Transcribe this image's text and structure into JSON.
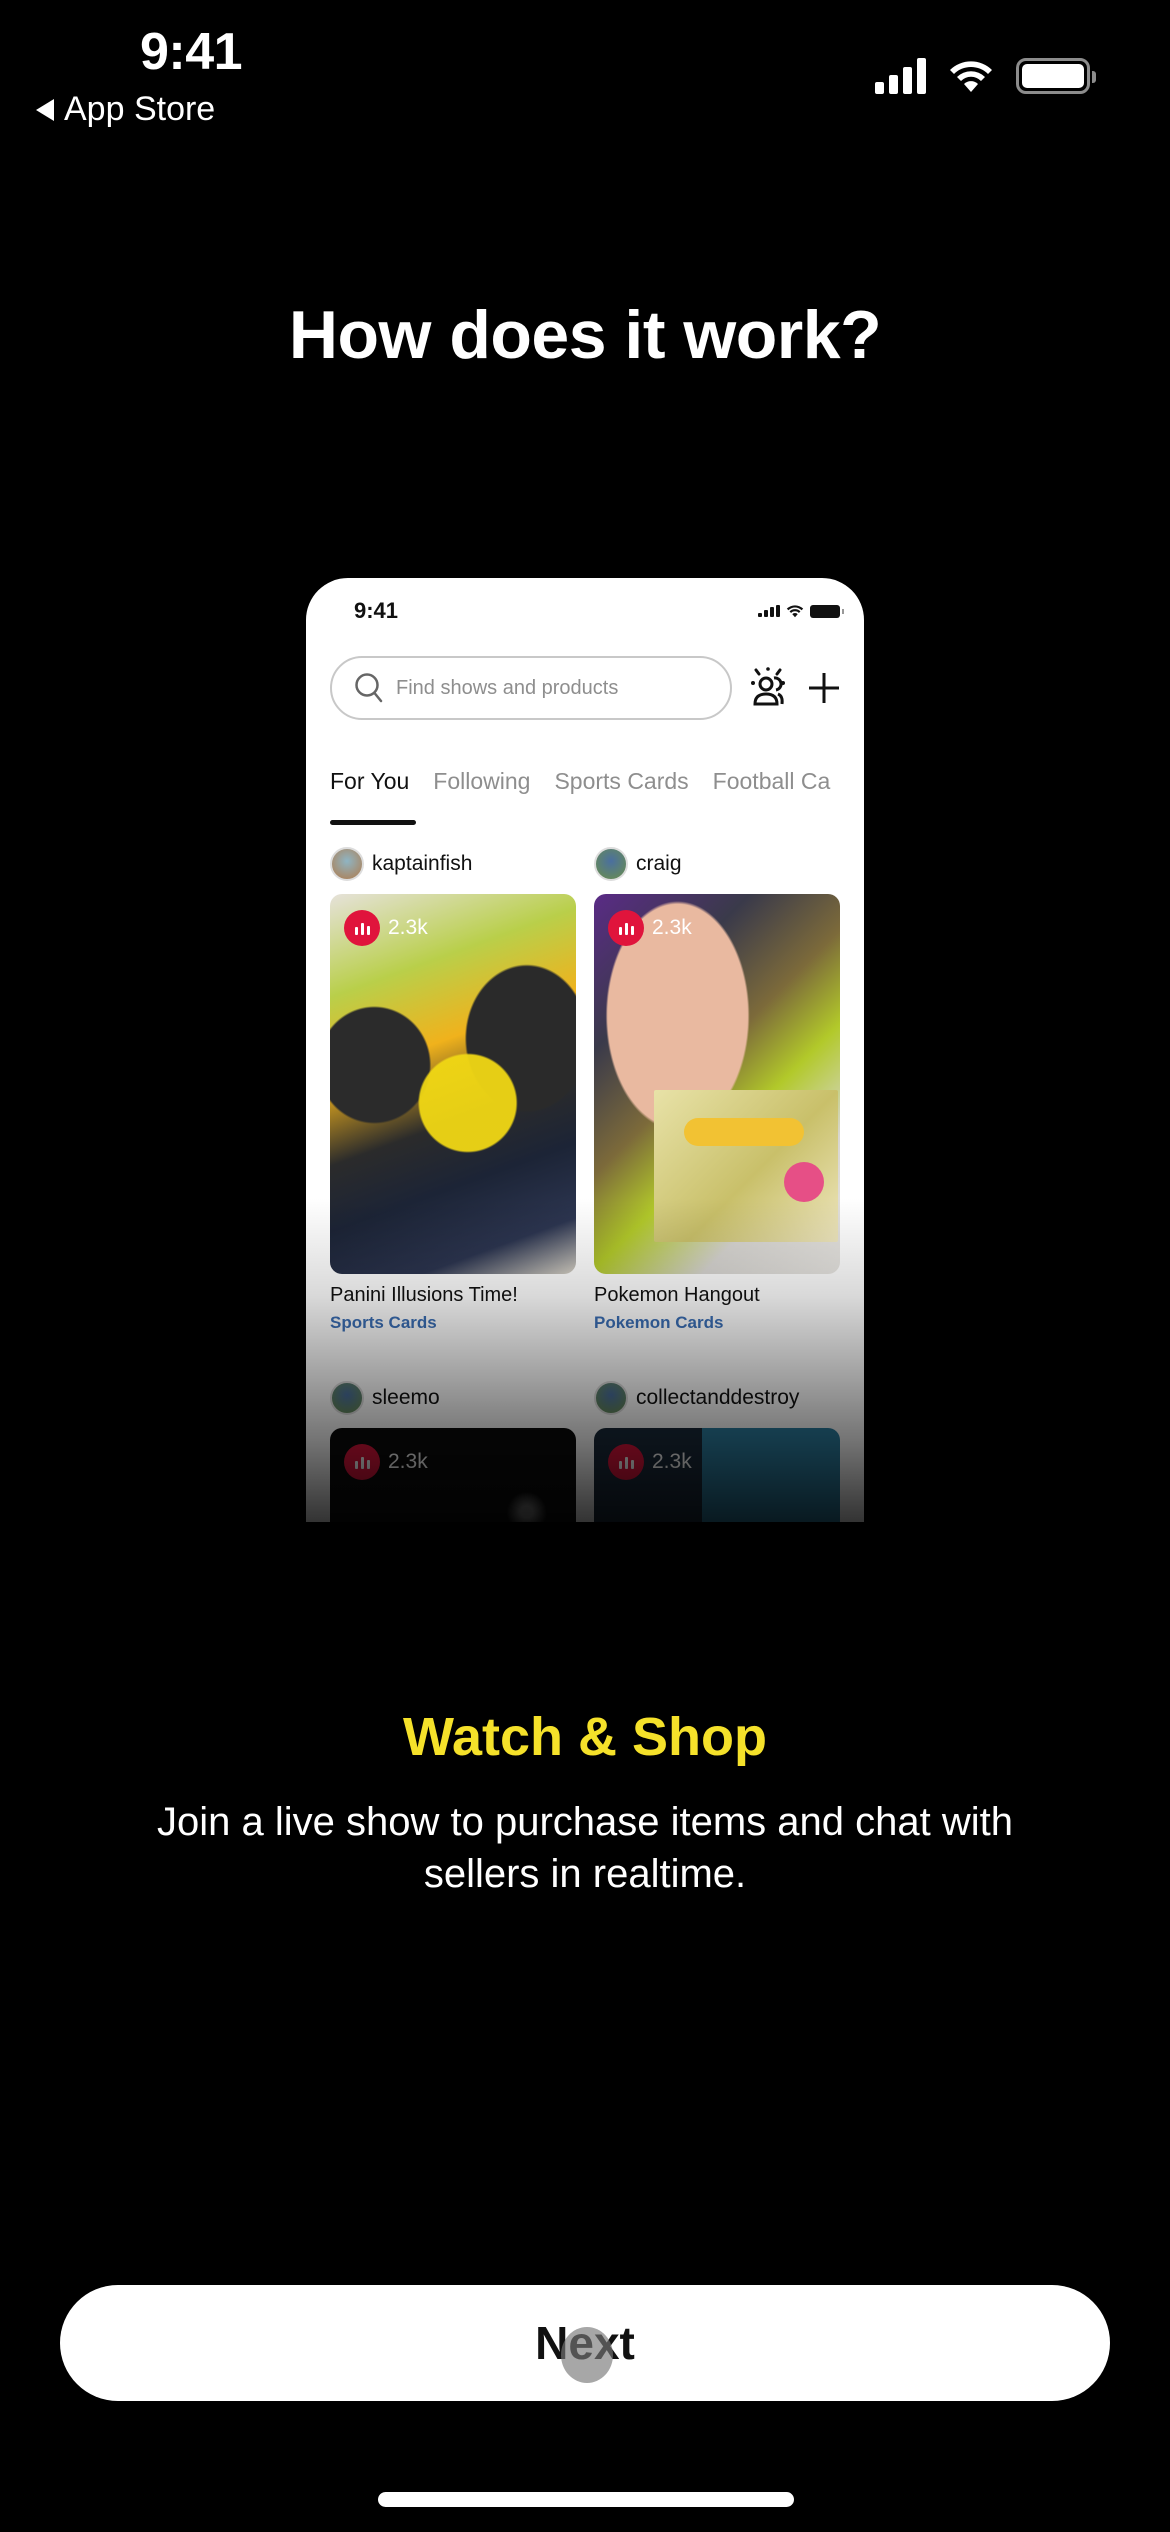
{
  "status_bar": {
    "time": "9:41",
    "back_label": "App Store",
    "icons": [
      "signal-icon",
      "wifi-icon",
      "battery-icon"
    ]
  },
  "page": {
    "title": "How does it work?"
  },
  "mockup": {
    "time": "9:41",
    "search_placeholder": "Find shows and products",
    "icons": [
      "search-icon",
      "people-icon",
      "plus-icon"
    ],
    "tabs": [
      {
        "label": "For You",
        "active": true
      },
      {
        "label": "Following",
        "active": false
      },
      {
        "label": "Sports Cards",
        "active": false
      },
      {
        "label": "Football Ca",
        "active": false
      }
    ],
    "cards": [
      {
        "user": "kaptainfish",
        "viewers": "2.3k",
        "title": "Panini Illusions Time!",
        "category": "Sports Cards"
      },
      {
        "user": "craig",
        "viewers": "2.3k",
        "title": "Pokemon Hangout",
        "category": "Pokemon Cards"
      },
      {
        "user": "sleemo",
        "viewers": "2.3k"
      },
      {
        "user": "collectanddestroy",
        "viewers": "2.3k"
      }
    ]
  },
  "feature": {
    "title": "Watch & Shop",
    "description": "Join a live show to purchase items and chat with sellers in realtime."
  },
  "actions": {
    "next_label": "Next"
  },
  "colors": {
    "background": "#000000",
    "accent_yellow": "#f5e12a",
    "live_badge": "#e0143c",
    "category_link": "#3b6fb6",
    "button_bg": "#ffffff"
  }
}
